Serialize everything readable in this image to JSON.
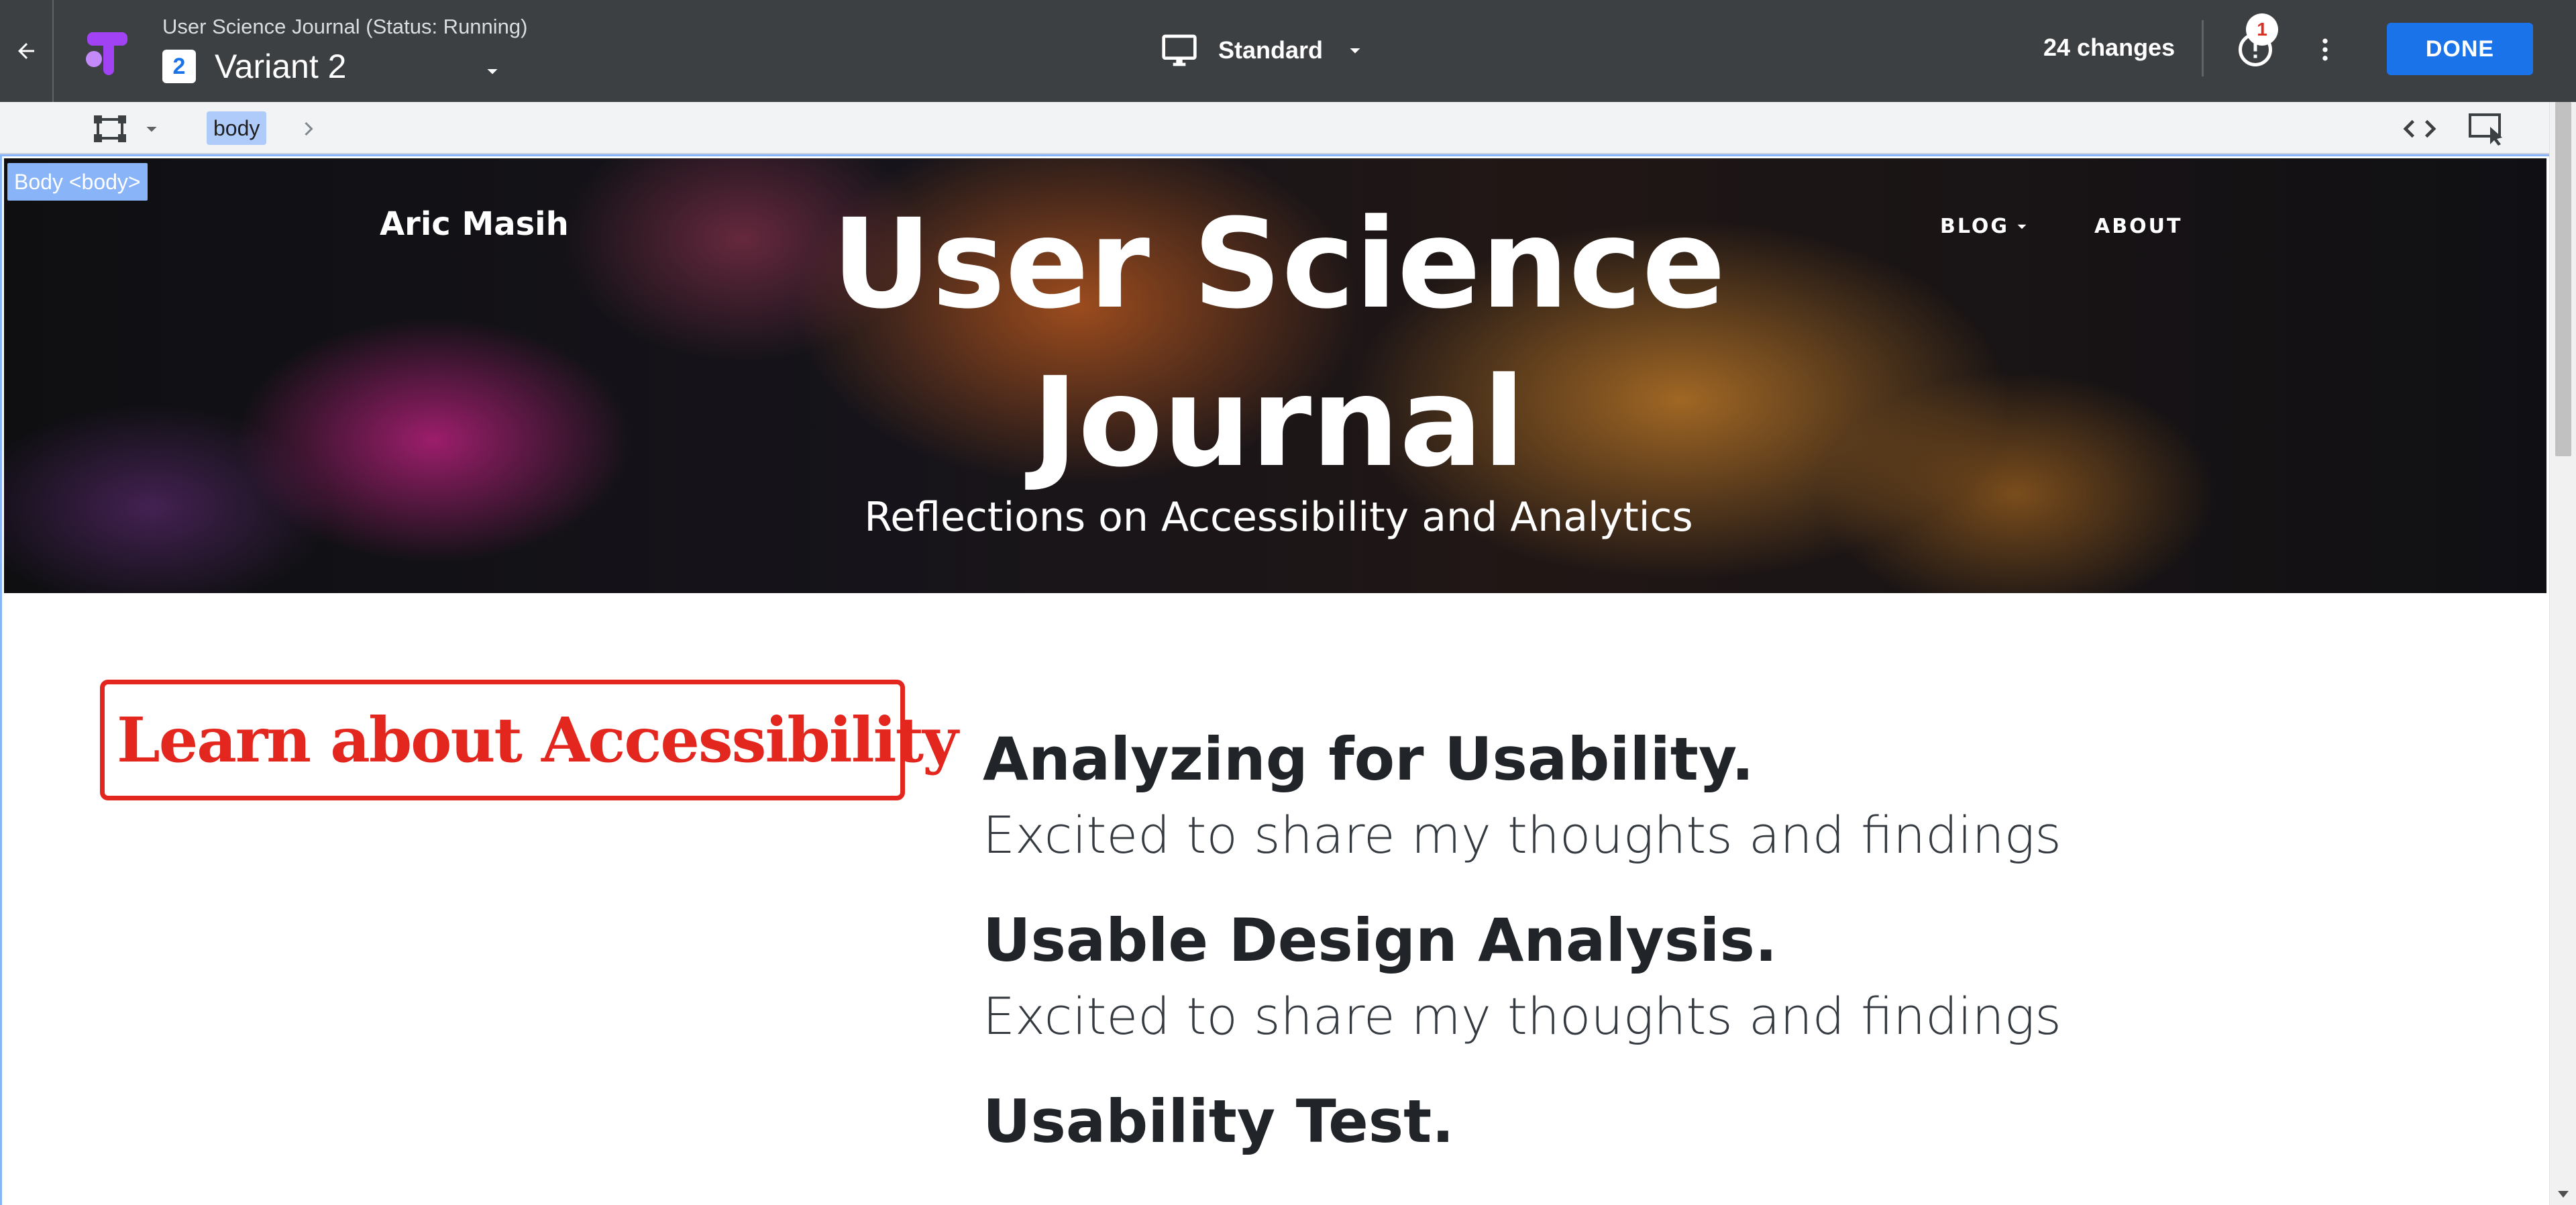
{
  "editor": {
    "experiment_title": "User Science Journal (Status: Running)",
    "variant_number": "2",
    "variant_name": "Variant 2",
    "device_label": "Standard",
    "changes_label": "24 changes",
    "alert_count": "1",
    "done_label": "DONE",
    "accent_color": "#1a73e8",
    "icons": [
      "back-arrow-icon",
      "optimize-logo-icon",
      "monitor-icon",
      "chevron-down-icon",
      "alert-icon",
      "more-vert-icon"
    ]
  },
  "toolbar": {
    "breadcrumb": "body",
    "icons": [
      "resize-frame-icon",
      "chevron-down-icon",
      "chevron-right-icon",
      "code-icon",
      "select-element-icon"
    ]
  },
  "preview": {
    "selection_label": "Body <body>",
    "site_brand": "Aric Masih",
    "site_title": "User Science Journal",
    "site_subtitle": "Reflections on Accessibility and Analytics",
    "nav": {
      "blog": "BLOG",
      "about": "ABOUT"
    },
    "cta_text": "Learn about Accessibility",
    "cta_color": "#e3261e",
    "posts": [
      {
        "title": "Analyzing for Usability.",
        "subtitle": "Excited to share my thoughts and findings"
      },
      {
        "title": "Usable Design Analysis.",
        "subtitle": "Excited to share my thoughts and findings"
      },
      {
        "title": "Usability Test.",
        "subtitle": ""
      }
    ]
  }
}
